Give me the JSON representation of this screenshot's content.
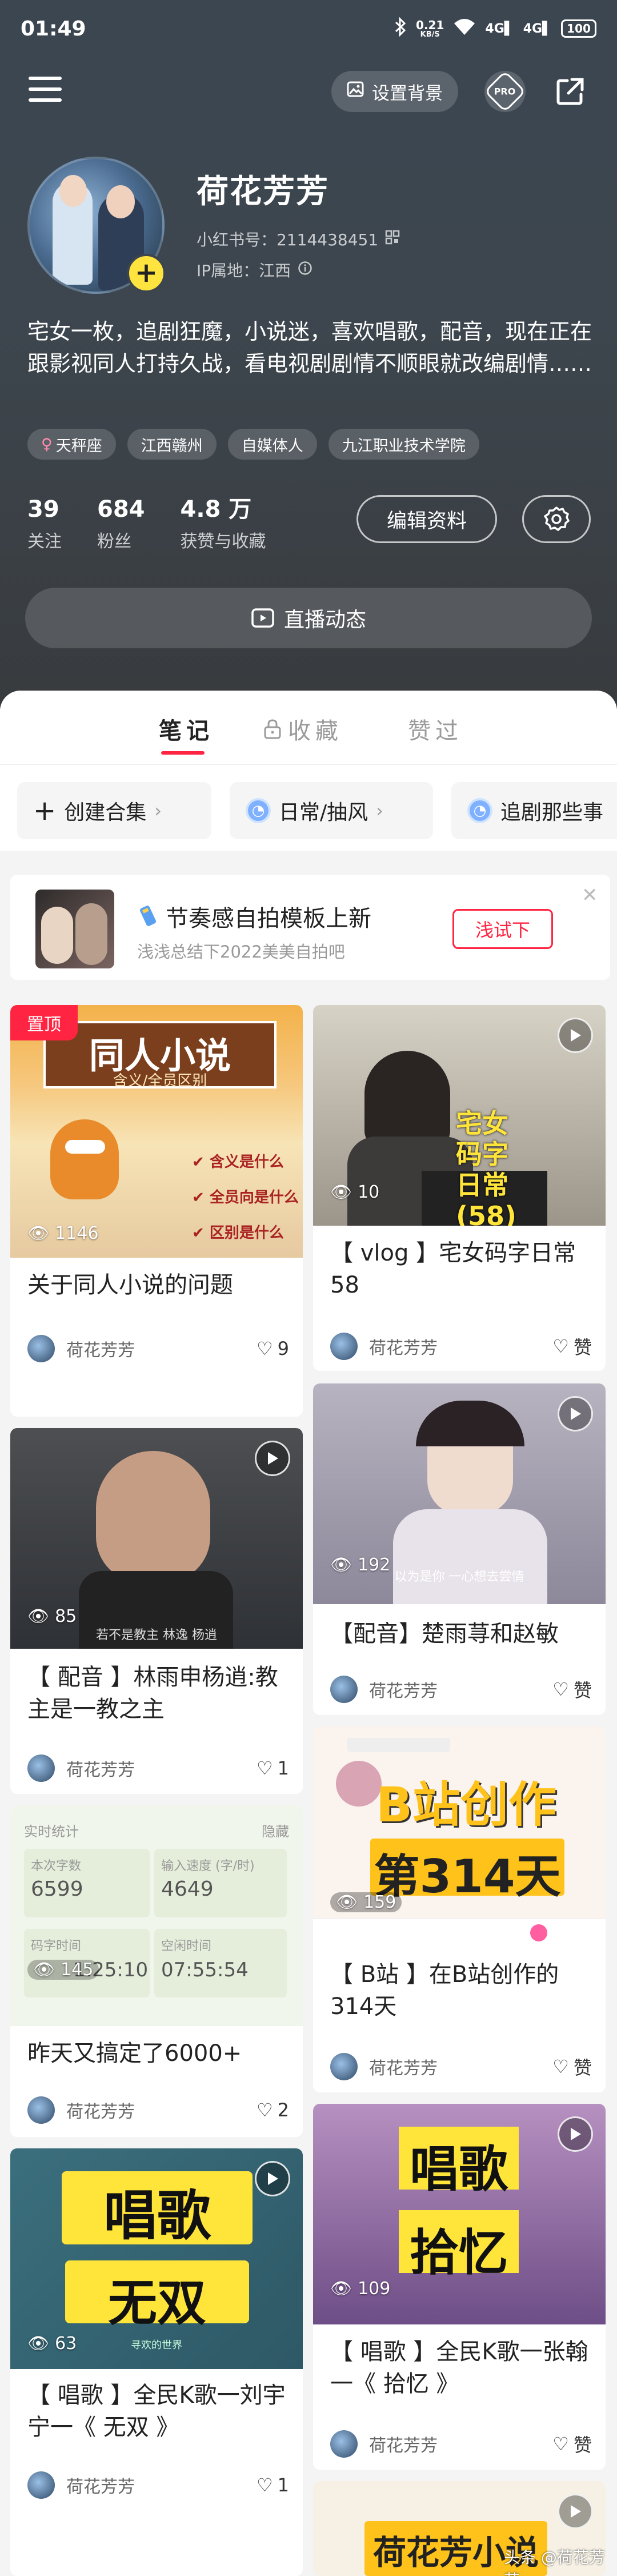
{
  "status_bar": {
    "time": "01:49",
    "net_speed_value": "0.21",
    "net_speed_unit": "KB/S",
    "signal_1": "4G",
    "signal_2": "4G",
    "battery": "100"
  },
  "top_bar": {
    "set_background_label": "设置背景",
    "pro_label": "PRO"
  },
  "profile": {
    "nickname": "荷花芳芳",
    "rednote_id": "小红书号：2114438451",
    "ip_location": "IP属地：江西",
    "bio": "宅女一枚，追剧狂魔，小说迷，喜欢唱歌，配音，现在正在跟影视同人打持久战，看电视剧剧情不顺眼就改编剧情……",
    "tags": [
      {
        "icon": "female-icon",
        "label": "天秤座"
      },
      {
        "label": "江西赣州"
      },
      {
        "label": "自媒体人"
      },
      {
        "label": "九江职业技术学院"
      }
    ],
    "stats": [
      {
        "value": "39",
        "label": "关注"
      },
      {
        "value": "684",
        "label": "粉丝"
      },
      {
        "value": "4.8 万",
        "label": "获赞与收藏"
      }
    ],
    "edit_label": "编辑资料",
    "live_label": "直播动态"
  },
  "tabs": [
    {
      "label": "笔记",
      "active": true
    },
    {
      "label": "收藏",
      "icon": "lock-icon"
    },
    {
      "label": "赞过"
    }
  ],
  "collections": [
    {
      "label": "创建合集",
      "icon": "plus-icon"
    },
    {
      "label": "日常/抽风"
    },
    {
      "label": "追剧那些事"
    }
  ],
  "promo": {
    "title": "节奏感自拍模板上新",
    "subtitle": "浅浅总结下2022美美自拍吧",
    "button": "浅试下"
  },
  "notes": [
    {
      "id": "n1",
      "pinned_label": "置顶",
      "views": "1146",
      "title": "关于同人小说的问题",
      "author": "荷花芳芳",
      "likes": "9",
      "overlay": {
        "headline": "同人小说",
        "sub": "含义/全员区别",
        "bullets": [
          "含义是什么",
          "全员向是什么",
          "区别是什么"
        ]
      }
    },
    {
      "id": "n2",
      "views": "10",
      "title": "【 vlog 】宅女码字日常58",
      "author": "荷花芳芳",
      "likes": "赞",
      "overlay": {
        "lines": [
          "宅女",
          "码字",
          "日常",
          "(58)"
        ]
      }
    },
    {
      "id": "n3",
      "views": "192",
      "title": "【配音】楚雨荨和赵敏",
      "author": "荷花芳芳",
      "likes": "赞",
      "overlay": {
        "subtitle": "以为是你 一心想去尝情"
      }
    },
    {
      "id": "n4",
      "views": "85",
      "title": "【 配音 】林雨申杨逍:教主是一教之主",
      "author": "荷花芳芳",
      "likes": "1",
      "overlay": {
        "subtitle": "若不是教主 林逸 杨逍"
      }
    },
    {
      "id": "n5",
      "views": "159",
      "title": "【 B站 】在B站创作的314天",
      "author": "荷花芳芳",
      "likes": "赞",
      "overlay": {
        "headline": "B站创作",
        "sub": "第314天"
      }
    },
    {
      "id": "n6",
      "views": "145",
      "title": "昨天又搞定了6000+",
      "author": "荷花芳芳",
      "likes": "2",
      "overlay": {
        "header_left": "实时统计",
        "header_right": "隐藏",
        "word_label": "本次字数",
        "word_value": "6599",
        "speed_label": "输入速度 (字/时)",
        "speed_value": "4649",
        "code_label": "码字时间",
        "code_value": "1:25:10",
        "idle_label": "空闲时间",
        "idle_value": "07:55:54"
      }
    },
    {
      "id": "n7",
      "views": "109",
      "title": "【 唱歌 】全民K歌一张翰一《 拾忆 》",
      "author": "荷花芳芳",
      "likes": "赞",
      "overlay": {
        "headline": "唱歌",
        "sub": "拾忆"
      }
    },
    {
      "id": "n8",
      "views": "63",
      "title": "【 唱歌 】全民K歌一刘宇宁一《 无双 》",
      "author": "荷花芳芳",
      "likes": "1",
      "overlay": {
        "headline": "唱歌",
        "sub": "无双",
        "caption": "寻欢的世界"
      }
    },
    {
      "id": "n9",
      "overlay": {
        "headline": "荷花芳小说"
      }
    }
  ],
  "watermark": "头条 @荷花芳芳"
}
